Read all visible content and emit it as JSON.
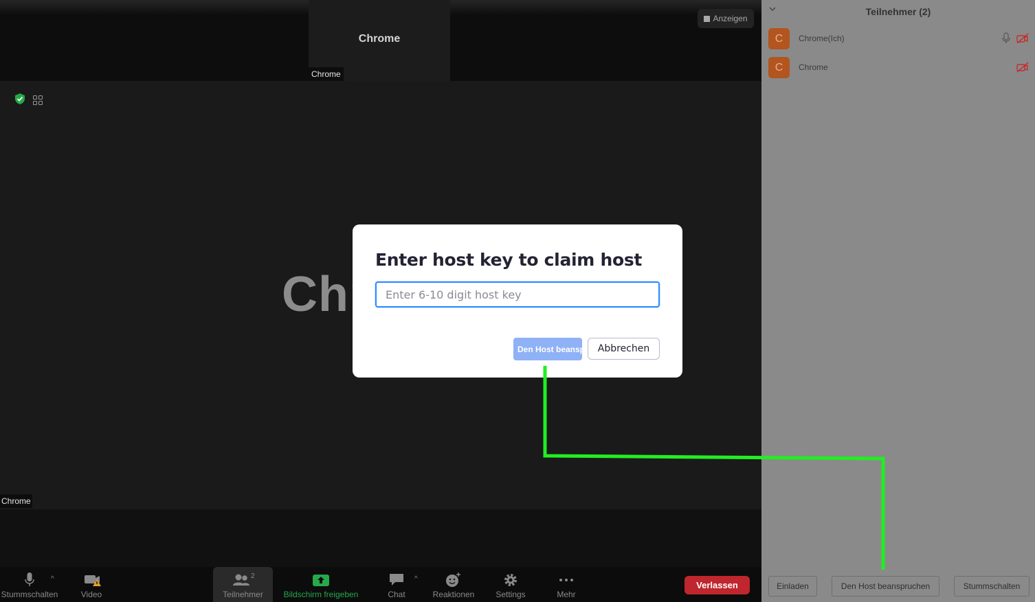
{
  "meeting": {
    "top_tile_name": "Chrome",
    "top_tile_label": "Chrome",
    "show_button_label": "Anzeigen",
    "main_name": "Chr",
    "bottom_label": "Chrome"
  },
  "toolbar": {
    "mute_label": "Stummschalten",
    "video_label": "Video",
    "participants_label": "Teilnehmer",
    "participants_count": "2",
    "share_label": "Bildschirm freigeben",
    "chat_label": "Chat",
    "reactions_label": "Reaktionen",
    "settings_label": "Settings",
    "more_label": "Mehr",
    "leave_label": "Verlassen"
  },
  "panel": {
    "title": "Teilnehmer (2)",
    "participants": [
      {
        "initial": "C",
        "name": "Chrome(Ich)"
      },
      {
        "initial": "C",
        "name": "Chrome"
      }
    ],
    "invite_label": "Einladen",
    "claim_host_label": "Den Host beanspruchen",
    "mute_all_label": "Stummschalten"
  },
  "modal": {
    "title": "Enter host key to claim host",
    "input_placeholder": "Enter 6-10 digit host key",
    "input_value": "",
    "claim_label": "Den Host beanspruchen",
    "cancel_label": "Abbrechen"
  },
  "colors": {
    "accent_blue": "#2d8cff",
    "leave_red": "#c0262d",
    "share_green": "#26a84a",
    "avatar_orange": "#b2551f",
    "annotation_green": "#22ee22"
  }
}
